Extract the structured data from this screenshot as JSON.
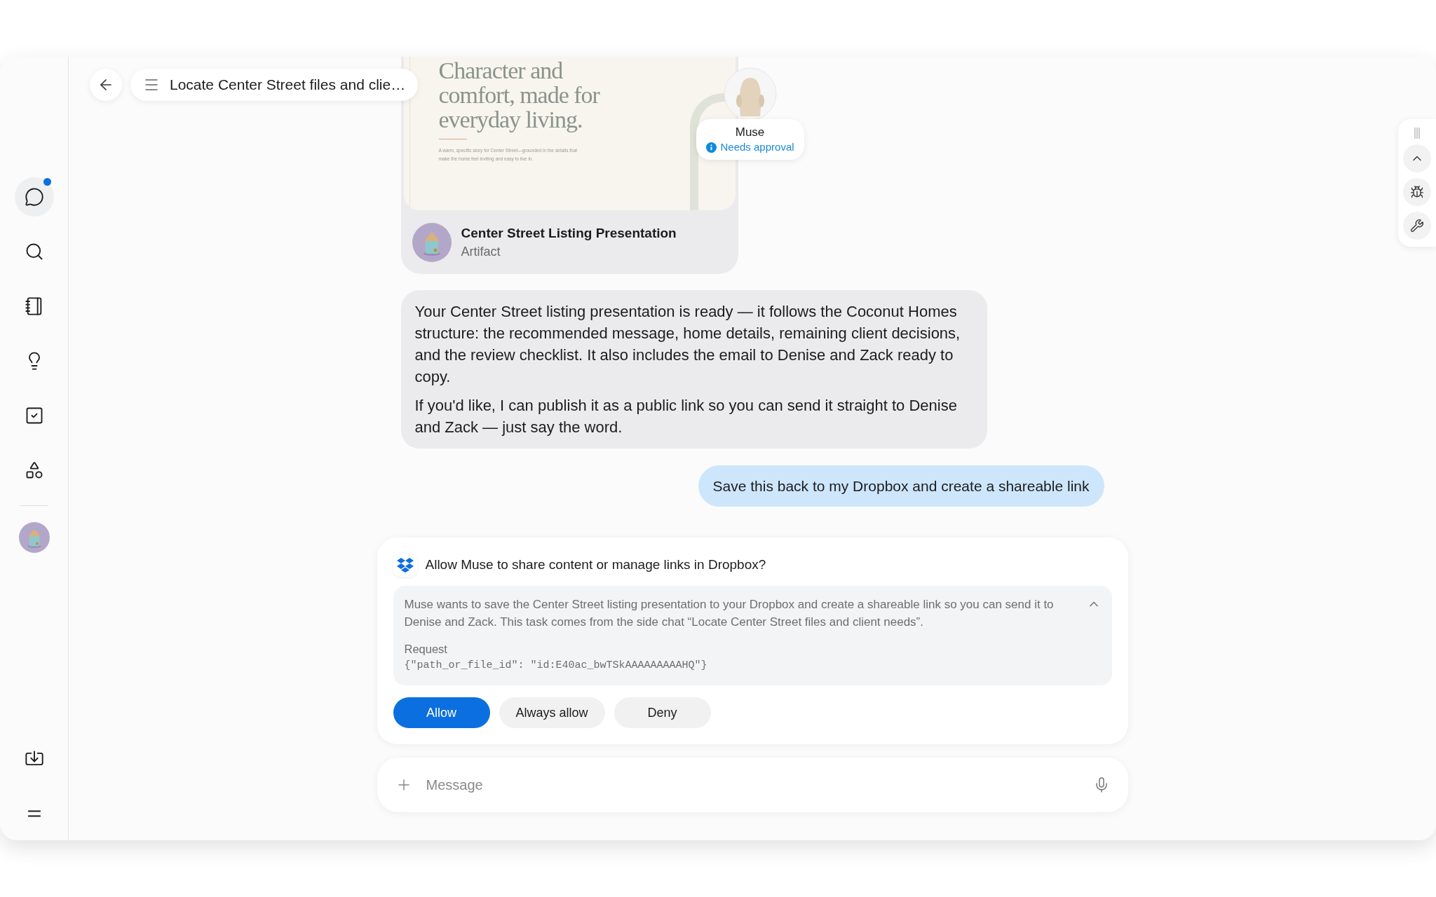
{
  "sidebar": {
    "items": [
      {
        "kind": "chat",
        "selected": true,
        "unread": true
      },
      {
        "kind": "search",
        "selected": false,
        "unread": false
      },
      {
        "kind": "notebook",
        "selected": false,
        "unread": false
      },
      {
        "kind": "ideas",
        "selected": false,
        "unread": false
      },
      {
        "kind": "tasks",
        "selected": false,
        "unread": false
      },
      {
        "kind": "apps",
        "selected": false,
        "unread": false
      },
      {
        "kind": "workspace",
        "selected": false,
        "unread": false
      }
    ],
    "bottom_items": [
      {
        "kind": "download"
      },
      {
        "kind": "menu"
      }
    ]
  },
  "header": {
    "title": "Locate Center Street files and clie…"
  },
  "artifact": {
    "preview": {
      "heading_lines": [
        "Character and",
        "comfort, made for",
        "everyday living."
      ],
      "summary": "A warm, specific story for Center Street—grounded in the details that make the home feel inviting and easy to live in."
    },
    "title": "Center Street Listing Presentation",
    "type": "Artifact"
  },
  "agent_badge": {
    "name": "Muse",
    "status": "Needs approval"
  },
  "messages": [
    {
      "kind": "assistant",
      "paragraphs": [
        "Your Center Street listing presentation is ready — it follows the Coconut Homes structure: the recommended message, home details, remaining client decisions, and the review checklist. It also includes the email to Denise and Zack ready to copy.",
        "If you'd like, I can publish it as a public link so you can send it straight to Denise and Zack — just say the word."
      ]
    },
    {
      "kind": "user",
      "paragraphs": [
        "Save this back to my Dropbox and create a shareable link"
      ]
    }
  ],
  "permission": {
    "question": "Allow Muse to share content or manage links in Dropbox?",
    "expanded": true,
    "description": "Muse wants to save the Center Street listing presentation to your Dropbox and create a shareable link so you can send it to Denise and Zack. This task comes from the side chat “Locate Center Street files and client needs”.",
    "request_label": "Request",
    "request_body": "{\"path_or_file_id\": \"id:E40ac_bwTSkAAAAAAAAAHQ\"}",
    "buttons": [
      {
        "label": "Allow",
        "kind": "primary"
      },
      {
        "label": "Always allow",
        "kind": "secondary"
      },
      {
        "label": "Deny",
        "kind": "secondary"
      }
    ]
  },
  "composer": {
    "placeholder": "Message"
  }
}
